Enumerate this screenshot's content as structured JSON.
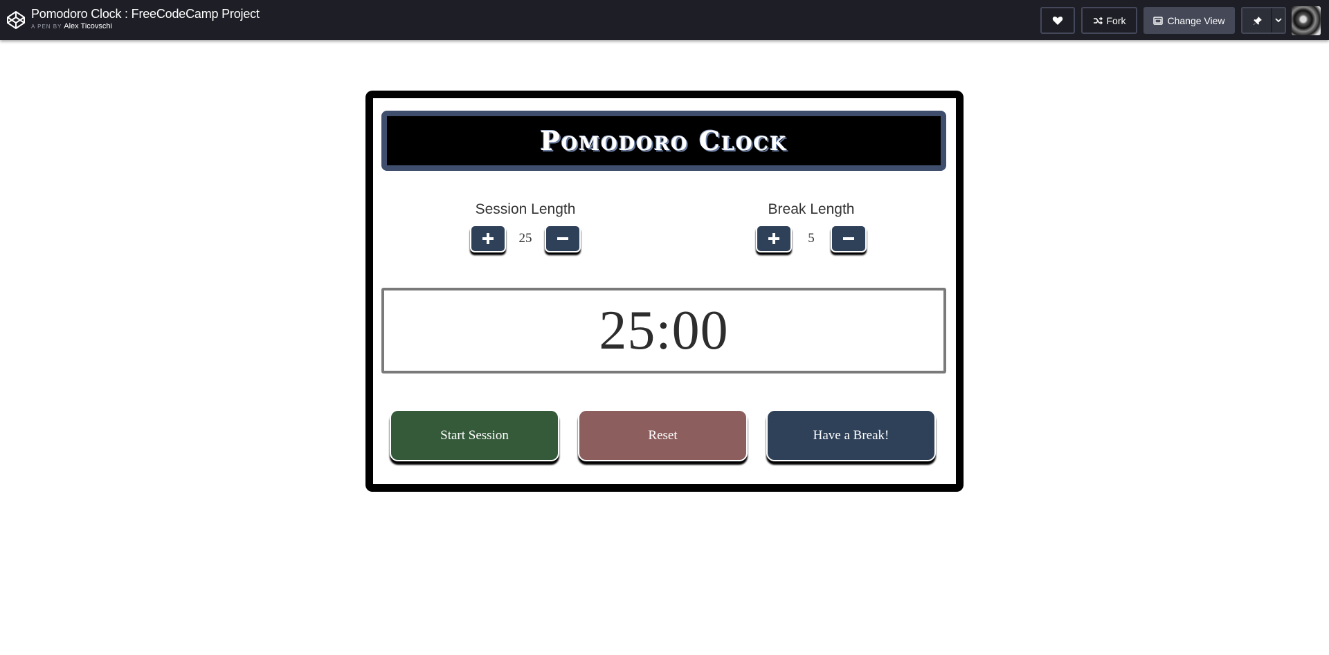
{
  "topbar": {
    "pen_title": "Pomodoro Clock : FreeCodeCamp Project",
    "by_label": "A PEN BY",
    "author": "Alex Ticovschi",
    "fork_label": "Fork",
    "change_view_label": "Change View",
    "icons": {
      "logo": "codepen-logo-icon",
      "heart": "heart-icon",
      "fork": "fork-icon",
      "view": "change-view-icon",
      "pin": "pin-icon",
      "chevron": "chevron-down-icon"
    }
  },
  "app": {
    "title": "Pomodoro Clock",
    "session": {
      "label": "Session Length",
      "value": "25"
    },
    "break": {
      "label": "Break Length",
      "value": "5"
    },
    "timer": "25:00",
    "buttons": {
      "start": "Start Session",
      "reset": "Reset",
      "break": "Have a Break!"
    }
  },
  "colors": {
    "topbar_bg": "#1e1f26",
    "title_border": "#3f4e6c",
    "adjust_button": "#2f4059",
    "start_button": "#355a3a",
    "reset_button": "#8d5e5e",
    "break_button": "#2f4059"
  }
}
